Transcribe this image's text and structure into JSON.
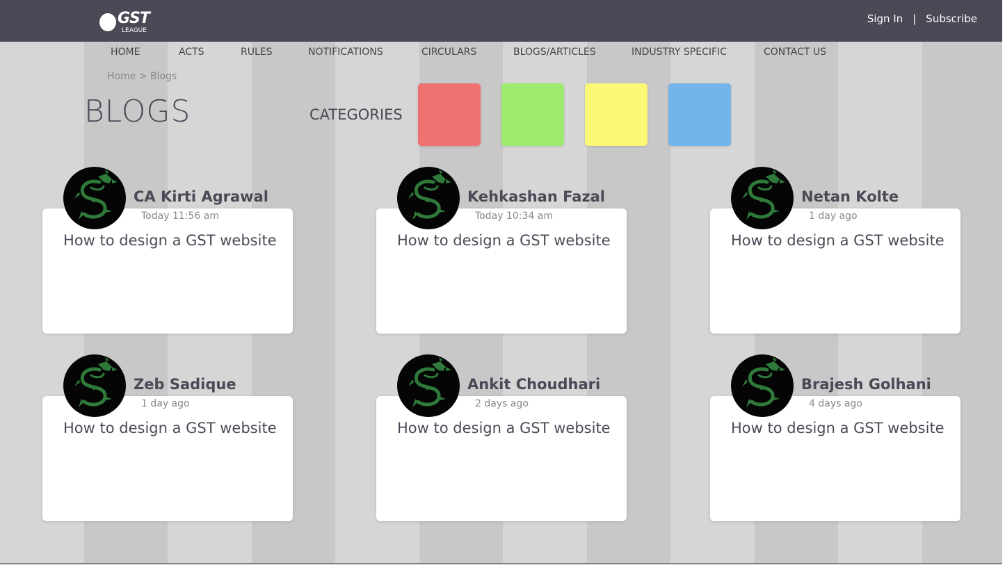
{
  "brand": {
    "logo_text": "GST",
    "logo_sub": "LEAGUE"
  },
  "auth": {
    "sign_in": "Sign In",
    "divider": "|",
    "subscribe": "Subscribe"
  },
  "nav": [
    {
      "label": "HOME"
    },
    {
      "label": "ACTS"
    },
    {
      "label": "RULES"
    },
    {
      "label": "NOTIFICATIONS"
    },
    {
      "label": "CIRCULARS"
    },
    {
      "label": "BLOGS/ARTICLES"
    },
    {
      "label": "INDUSTRY SPECIFIC"
    },
    {
      "label": "CONTACT US"
    }
  ],
  "breadcrumb": "Home > Blogs",
  "page_title": "BLOGS",
  "categories": {
    "label": "CATEGORIES",
    "swatches": [
      {
        "color": "#ee7272"
      },
      {
        "color": "#9ceb6e"
      },
      {
        "color": "#fbf876"
      },
      {
        "color": "#73b4ea"
      }
    ]
  },
  "posts": [
    {
      "author": "CA Kirti Agrawal",
      "time": "Today 11:56 am",
      "title": "How to design a GST website",
      "avatar_icon": "dragon-icon"
    },
    {
      "author": "Kehkashan Fazal",
      "time": "Today 10:34 am",
      "title": "How to design a GST website",
      "avatar_icon": "dragon-icon"
    },
    {
      "author": "Netan Kolte",
      "time": "1 day ago",
      "title": "How to design a GST website",
      "avatar_icon": "dragon-icon"
    },
    {
      "author": "Zeb Sadique",
      "time": "1 day ago",
      "title": "How to design a GST website",
      "avatar_icon": "dragon-icon"
    },
    {
      "author": "Ankit Choudhari",
      "time": "2 days ago",
      "title": "How to design a GST website",
      "avatar_icon": "dragon-icon"
    },
    {
      "author": "Brajesh Golhani",
      "time": "4 days ago",
      "title": "How to design a GST website",
      "avatar_icon": "dragon-icon"
    }
  ],
  "colors": {
    "header_bg": "#4a4a57",
    "accent_text": "#4a4a57",
    "dragon_green": "#2f7a3a"
  }
}
